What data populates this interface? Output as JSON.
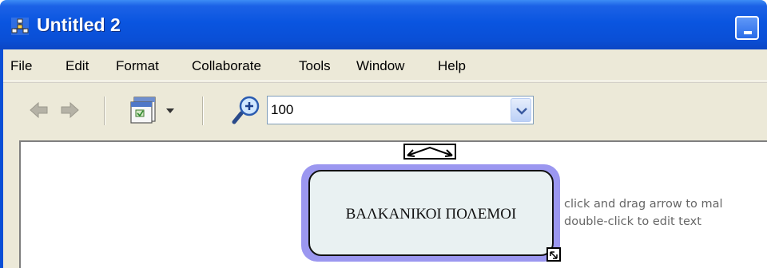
{
  "window": {
    "title": "Untitled 2",
    "app_icon": "mindmap-app-icon",
    "minimize_icon": "minimize-icon"
  },
  "menu": {
    "items": [
      {
        "label": "File"
      },
      {
        "label": "Edit"
      },
      {
        "label": "Format"
      },
      {
        "label": "Collaborate"
      },
      {
        "label": "Tools"
      },
      {
        "label": "Window"
      },
      {
        "label": "Help"
      }
    ]
  },
  "toolbar": {
    "back_icon": "back-arrow-icon",
    "forward_icon": "forward-arrow-icon",
    "view_icon": "view-options-icon",
    "zoom_icon": "zoom-in-icon",
    "zoom_value": "100",
    "dropdown_icon": "chevron-down-icon"
  },
  "canvas": {
    "node_text": "ΒΑΛΚΑΝΙΚΟΙ ΠΟΛΕΜΟΙ",
    "hint_line1": "click and drag arrow to mal",
    "hint_line2": "double-click to edit text",
    "accent_color": "#9b97f0",
    "node_fill": "#e9f1f2"
  }
}
